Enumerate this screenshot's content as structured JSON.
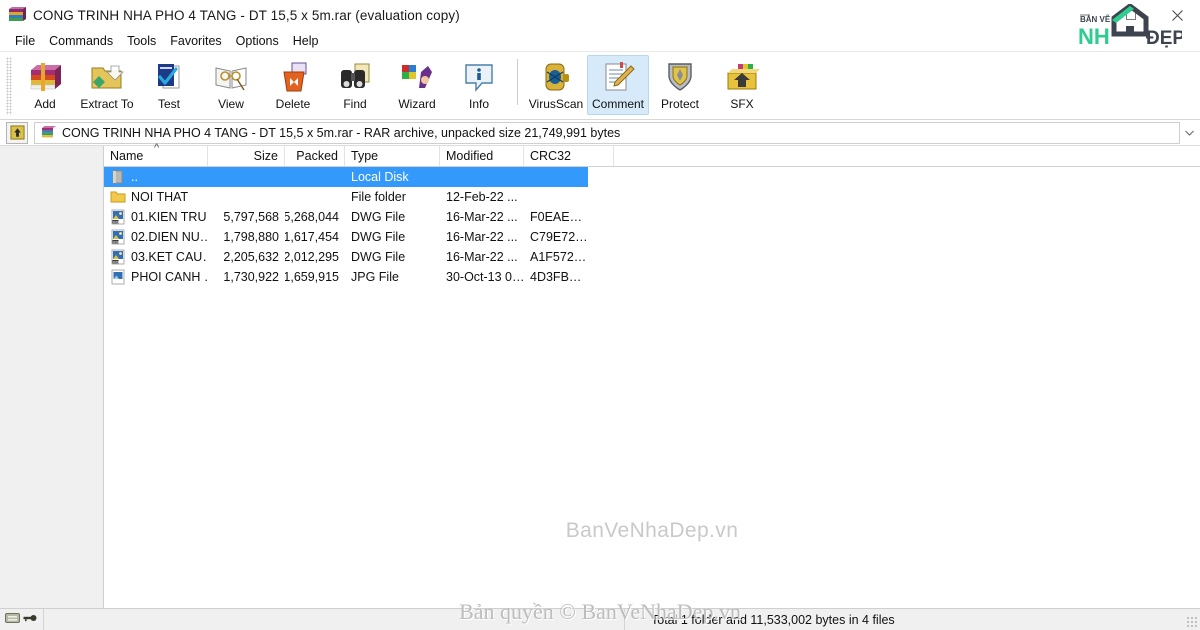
{
  "window": {
    "title": "CONG TRINH NHA PHO 4 TANG -  DT 15,5 x 5m.rar (evaluation copy)",
    "app_icon": "winrar-books-icon",
    "minimize_label": "–",
    "maximize_label": "❐",
    "close_label": "✕"
  },
  "brand": {
    "top_text": "BẢN VẼ",
    "name_left": "NH",
    "name_right": "ĐẸP",
    "accent": "#2ecc8f",
    "dark": "#3d4450"
  },
  "menu": {
    "items": [
      {
        "label": "File"
      },
      {
        "label": "Commands"
      },
      {
        "label": "Tools"
      },
      {
        "label": "Favorites"
      },
      {
        "label": "Options"
      },
      {
        "label": "Help"
      }
    ]
  },
  "toolbar": {
    "buttons": [
      {
        "label": "Add",
        "icon": "add-archive-icon",
        "active": false
      },
      {
        "label": "Extract To",
        "icon": "extract-folder-icon",
        "active": false
      },
      {
        "label": "Test",
        "icon": "test-check-icon",
        "active": false
      },
      {
        "label": "View",
        "icon": "view-book-icon",
        "active": false
      },
      {
        "label": "Delete",
        "icon": "delete-bin-icon",
        "active": false
      },
      {
        "label": "Find",
        "icon": "find-binoculars-icon",
        "active": false
      },
      {
        "label": "Wizard",
        "icon": "wizard-hat-icon",
        "active": false
      },
      {
        "label": "Info",
        "icon": "info-balloon-icon",
        "active": false
      },
      {
        "label": "VirusScan",
        "icon": "virusscan-bug-icon",
        "active": false
      },
      {
        "label": "Comment",
        "icon": "comment-pencil-icon",
        "active": true
      },
      {
        "label": "Protect",
        "icon": "protect-shield-icon",
        "active": false
      },
      {
        "label": "SFX",
        "icon": "sfx-box-icon",
        "active": false
      }
    ],
    "separator_after": [
      "Wizard",
      "Info"
    ]
  },
  "address": {
    "up_icon": "up-folder-icon",
    "archive_icon": "winrar-archive-icon",
    "text": "CONG TRINH NHA PHO 4 TANG -  DT 15,5 x 5m.rar - RAR archive, unpacked size 21,749,991 bytes",
    "dropdown_icon": "chevron-down-icon"
  },
  "columns": [
    {
      "key": "name",
      "label": "Name",
      "align": "left",
      "width": 104,
      "sorted": "asc"
    },
    {
      "key": "size",
      "label": "Size",
      "align": "right",
      "width": 77
    },
    {
      "key": "packed",
      "label": "Packed",
      "align": "right",
      "width": 60
    },
    {
      "key": "type",
      "label": "Type",
      "align": "left",
      "width": 95
    },
    {
      "key": "modified",
      "label": "Modified",
      "align": "left",
      "width": 84
    },
    {
      "key": "crc",
      "label": "CRC32",
      "align": "left",
      "width": 90
    }
  ],
  "files": [
    {
      "name": "..",
      "icon": "parent-folder-icon",
      "size": "",
      "packed": "",
      "type": "Local Disk",
      "modified": "",
      "crc": "",
      "selected": true
    },
    {
      "name": "NOI THAT",
      "icon": "folder-icon",
      "size": "",
      "packed": "",
      "type": "File folder",
      "modified": "12-Feb-22 ...",
      "crc": "",
      "selected": false
    },
    {
      "name": "01.KIEN TRU…",
      "icon": "dwg-file-icon",
      "size": "5,797,568",
      "packed": "5,268,044",
      "type": "DWG File",
      "modified": "16-Mar-22 ...",
      "crc": "F0EAE…",
      "selected": false
    },
    {
      "name": "02.DIEN NU…",
      "icon": "dwg-file-icon",
      "size": "1,798,880",
      "packed": "1,617,454",
      "type": "DWG File",
      "modified": "16-Mar-22 ...",
      "crc": "C79E72…",
      "selected": false
    },
    {
      "name": "03.KET CAU….",
      "icon": "dwg-file-icon",
      "size": "2,205,632",
      "packed": "2,012,295",
      "type": "DWG File",
      "modified": "16-Mar-22 ...",
      "crc": "A1F572…",
      "selected": false
    },
    {
      "name": "PHOI CANH …",
      "icon": "jpg-file-icon",
      "size": "1,730,922",
      "packed": "1,659,915",
      "type": "JPG File",
      "modified": "30-Oct-13 0…",
      "crc": "4D3FB…",
      "selected": false
    }
  ],
  "watermarks": {
    "center": "BanVeNhaDep.vn",
    "bottom": "Bản quyền © BanVeNhaDep.vn"
  },
  "statusbar": {
    "disk_icon": "disk-icon",
    "key_icon": "key-icon",
    "total": "Total 1 folder and 11,533,002 bytes in 4 files"
  },
  "colors": {
    "selection": "#3399fa",
    "toolbar_active": "#d7eaf9",
    "panel": "#f0f0f0"
  }
}
